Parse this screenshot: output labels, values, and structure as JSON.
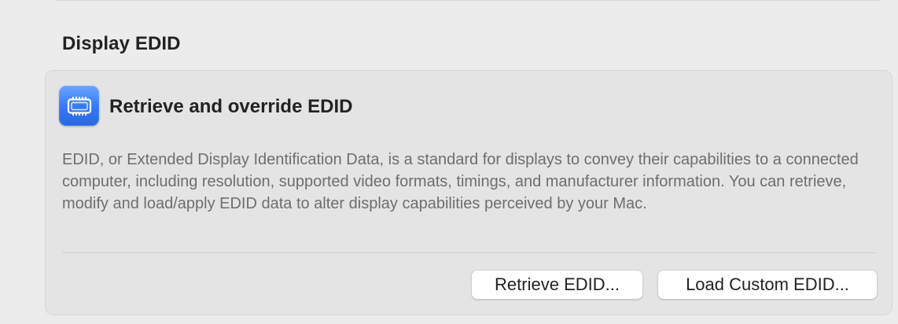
{
  "section": {
    "title": "Display EDID"
  },
  "card": {
    "icon": "display-chip-icon",
    "title": "Retrieve and override EDID",
    "description": "EDID, or Extended Display Identification Data, is a standard for displays to convey their capabilities to a connected computer, including resolution, supported video formats, timings, and manufacturer information. You can retrieve, modify and load/apply EDID data to alter display capabilities perceived by your Mac."
  },
  "buttons": {
    "retrieve_label": "Retrieve EDID...",
    "load_label": "Load Custom EDID..."
  },
  "colors": {
    "icon_accent": "#3478f6",
    "background": "#ececec",
    "card_background": "#e4e4e4"
  }
}
